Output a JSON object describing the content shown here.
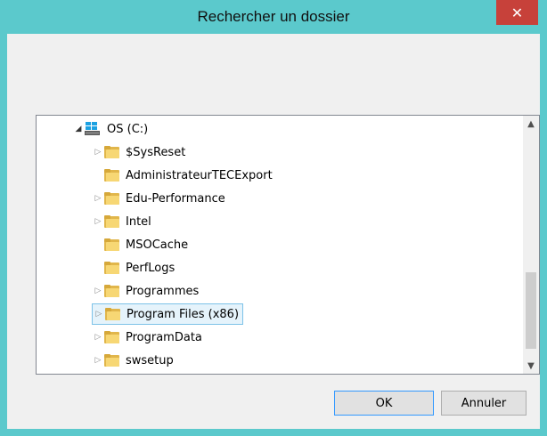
{
  "window": {
    "title": "Rechercher un dossier",
    "close_glyph": "✕"
  },
  "tree": {
    "root": {
      "label": "OS (C:)",
      "icon": "drive-icon"
    },
    "items": [
      {
        "label": "$SysReset",
        "expandable": true,
        "selected": false
      },
      {
        "label": "AdministrateurTECExport",
        "expandable": false,
        "selected": false
      },
      {
        "label": "Edu-Performance",
        "expandable": true,
        "selected": false
      },
      {
        "label": "Intel",
        "expandable": true,
        "selected": false
      },
      {
        "label": "MSOCache",
        "expandable": false,
        "selected": false
      },
      {
        "label": "PerfLogs",
        "expandable": false,
        "selected": false
      },
      {
        "label": "Programmes",
        "expandable": true,
        "selected": false
      },
      {
        "label": "Program Files (x86)",
        "expandable": true,
        "selected": true
      },
      {
        "label": "ProgramData",
        "expandable": true,
        "selected": false
      },
      {
        "label": "swsetup",
        "expandable": true,
        "selected": false
      }
    ]
  },
  "buttons": {
    "ok_label": "OK",
    "cancel_label": "Annuler"
  },
  "colors": {
    "titlebar": "#5bc9cc",
    "close": "#c7413a",
    "selection": "#e5f3fb"
  }
}
